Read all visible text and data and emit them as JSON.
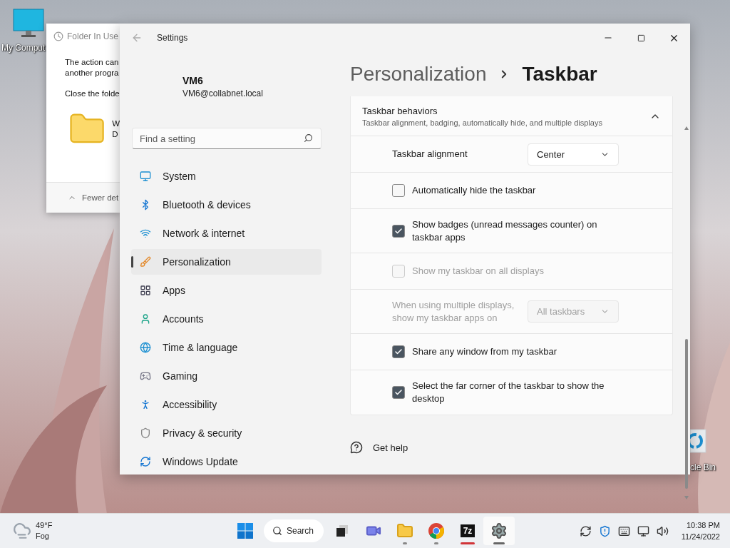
{
  "desktop": {
    "icons": [
      {
        "label": "My Comput"
      },
      {
        "label": "cle Bin"
      }
    ]
  },
  "dialog": {
    "title": "Folder In Use",
    "lines": [
      "The action can",
      "another progra"
    ],
    "prompt": "Close the folde",
    "file_lines": [
      "W",
      "D"
    ],
    "toggle": "Fewer det"
  },
  "settings": {
    "title": "Settings",
    "user": {
      "name": "VM6",
      "email": "VM6@collabnet.local"
    },
    "search": {
      "placeholder": "Find a setting"
    },
    "nav": [
      {
        "label": "System",
        "selected": false
      },
      {
        "label": "Bluetooth & devices",
        "selected": false
      },
      {
        "label": "Network & internet",
        "selected": false
      },
      {
        "label": "Personalization",
        "selected": true
      },
      {
        "label": "Apps",
        "selected": false
      },
      {
        "label": "Accounts",
        "selected": false
      },
      {
        "label": "Time & language",
        "selected": false
      },
      {
        "label": "Gaming",
        "selected": false
      },
      {
        "label": "Accessibility",
        "selected": false
      },
      {
        "label": "Privacy & security",
        "selected": false
      },
      {
        "label": "Windows Update",
        "selected": false
      }
    ],
    "breadcrumb": [
      "Personalization",
      "Taskbar"
    ],
    "section": {
      "title": "Taskbar behaviors",
      "subtitle": "Taskbar alignment, badging, automatically hide, and multiple displays",
      "expanded": true,
      "rows": [
        {
          "kind": "dropdown",
          "label": "Taskbar alignment",
          "value": "Center",
          "disabled": false
        },
        {
          "kind": "checkbox",
          "label": "Automatically hide the taskbar",
          "checked": false,
          "disabled": false
        },
        {
          "kind": "checkbox",
          "label": "Show badges (unread messages counter) on taskbar apps",
          "checked": true,
          "disabled": false
        },
        {
          "kind": "checkbox",
          "label": "Show my taskbar on all displays",
          "checked": false,
          "disabled": true
        },
        {
          "kind": "dropdown",
          "label": "When using multiple displays, show my taskbar apps on",
          "value": "All taskbars",
          "disabled": true
        },
        {
          "kind": "checkbox",
          "label": "Share any window from my taskbar",
          "checked": true,
          "disabled": false
        },
        {
          "kind": "checkbox",
          "label": "Select the far corner of the taskbar to show the desktop",
          "checked": true,
          "disabled": false
        }
      ]
    },
    "help": "Get help"
  },
  "taskbar": {
    "weather": {
      "temp": "49°F",
      "condition": "Fog"
    },
    "search": "Search",
    "apps": [
      {
        "kind": "taskview",
        "running": false,
        "flashing": false,
        "selected": false
      },
      {
        "kind": "chat",
        "running": false,
        "flashing": false,
        "selected": false
      },
      {
        "kind": "explorer",
        "running": true,
        "flashing": false,
        "selected": false
      },
      {
        "kind": "chrome",
        "running": true,
        "flashing": false,
        "selected": false
      },
      {
        "kind": "archiver",
        "label": "7z",
        "running": true,
        "flashing": true,
        "selected": false
      },
      {
        "kind": "settings",
        "running": true,
        "flashing": false,
        "selected": true
      }
    ],
    "time": "10:38 PM",
    "date": "11/24/2022"
  }
}
